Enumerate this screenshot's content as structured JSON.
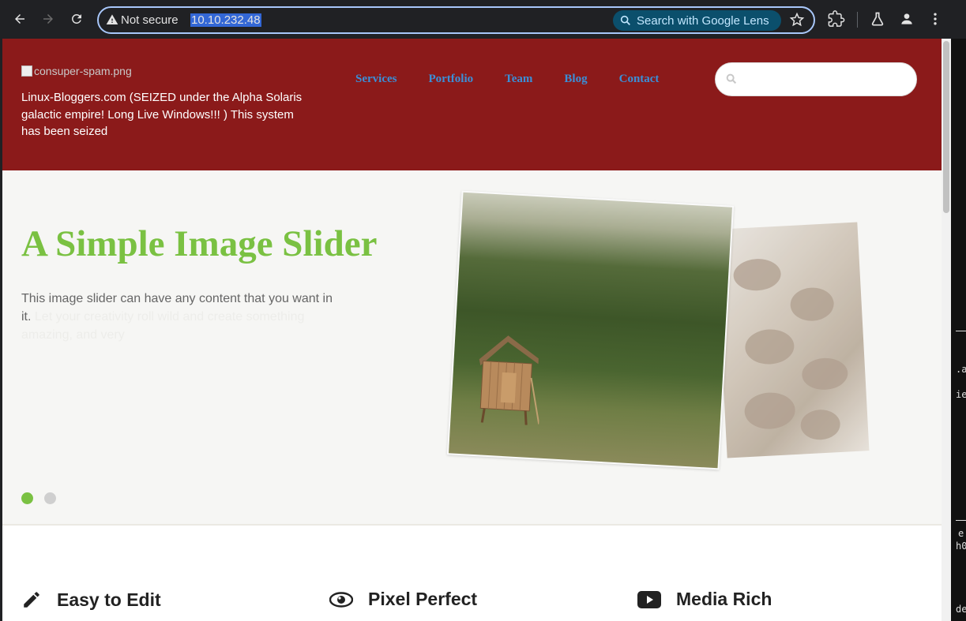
{
  "browser": {
    "security_label": "Not secure",
    "url": "10.10.232.48",
    "lens_label": "Search with Google Lens"
  },
  "header": {
    "logo_alt": "consuper-spam.png",
    "site_description": "Linux-Bloggers.com (SEIZED under the Alpha Solaris galactic empire! Long Live Windows!!! ) This system has been seized",
    "nav": [
      "Services",
      "Portfolio",
      "Team",
      "Blog",
      "Contact"
    ],
    "search_placeholder": ""
  },
  "slider": {
    "title": "A Simple Image Slider",
    "text": "This image slider can have any content that you want in it.",
    "ghost_text": "                     it. Let your creativity roll wild and create something amazing, and very",
    "active_slide": 1,
    "slide_count": 2,
    "colors": {
      "title": "#7ac142",
      "active_dot": "#7ac142",
      "inactive_dot": "#cfcfcf"
    }
  },
  "features": [
    {
      "icon": "pencil-icon",
      "title": "Easy to Edit"
    },
    {
      "icon": "eye-icon",
      "title": "Pixel Perfect"
    },
    {
      "icon": "youtube-icon",
      "title": "Media Rich"
    }
  ],
  "side_strip": [
    ".a",
    "ie",
    "e",
    "h0",
    "de"
  ],
  "colors": {
    "header_bg": "#8b1a1a",
    "nav_link": "#3a8fd8"
  }
}
